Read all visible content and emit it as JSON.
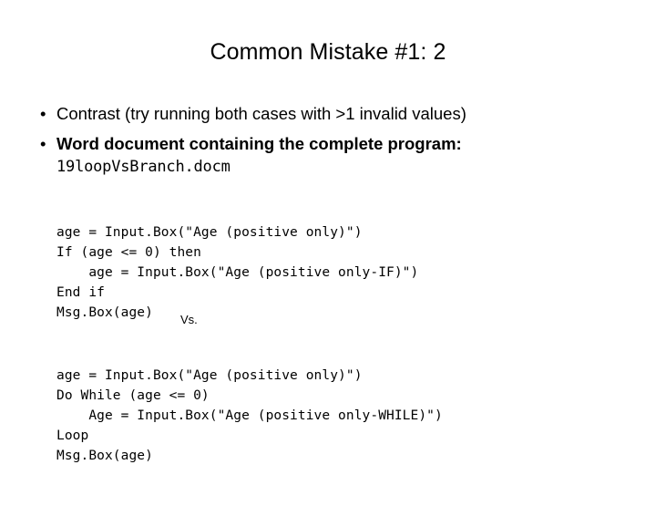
{
  "slide": {
    "title": "Common Mistake #1: 2",
    "bullets": [
      {
        "marker": "•",
        "text": "Contrast (try running both cases with >1 invalid values)",
        "bold": false,
        "mono_line": ""
      },
      {
        "marker": "•",
        "text": "Word document containing the complete program:",
        "bold": true,
        "mono_line": "19loopVsBranch.docm"
      }
    ],
    "code_block_1": {
      "lines": [
        "age = Input.Box(\"Age (positive only)\")",
        "If (age <= 0) then",
        "    age = Input.Box(\"Age (positive only-IF)\")",
        "End if",
        "Msg.Box(age)"
      ]
    },
    "separator": "Vs.",
    "code_block_2": {
      "lines": [
        "age = Input.Box(\"Age (positive only)\")",
        "Do While (age <= 0)",
        "    Age = Input.Box(\"Age (positive only-WHILE)\")",
        "Loop",
        "Msg.Box(age)"
      ]
    }
  }
}
